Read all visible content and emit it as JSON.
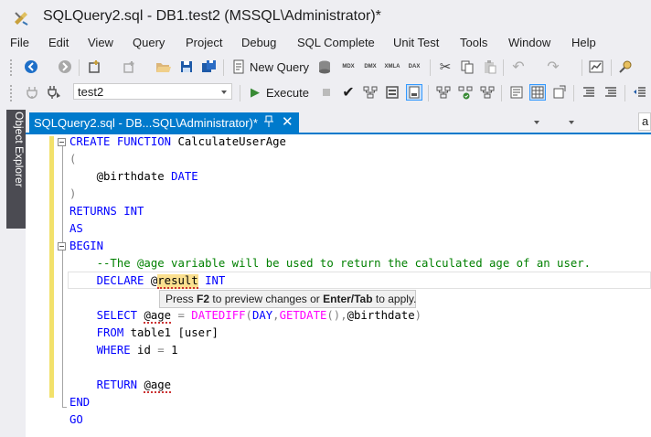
{
  "window": {
    "title": "SQLQuery2.sql - DB1.test2 (MSSQL\\Administrator)*"
  },
  "menu": [
    "File",
    "Edit",
    "View",
    "Query",
    "Project",
    "Debug",
    "SQL Complete",
    "Unit Test",
    "Tools",
    "Window",
    "Help"
  ],
  "toolbar1": {
    "new_query_label": "New Query",
    "query_type_icons": [
      "MDX",
      "DMX",
      "XMLA",
      "DAX"
    ],
    "search_partial": "a"
  },
  "toolbar2": {
    "database": "test2",
    "execute_label": "Execute"
  },
  "side_panel": {
    "label": "Object Explorer"
  },
  "document_tab": {
    "label": "SQLQuery2.sql - DB...SQL\\Administrator)*"
  },
  "editor": {
    "lines": [
      {
        "segments": [
          {
            "t": "CREATE FUNCTION",
            "c": "kw"
          },
          {
            "t": " CalculateUserAge",
            "c": ""
          }
        ]
      },
      {
        "segments": [
          {
            "t": "(",
            "c": "op"
          }
        ]
      },
      {
        "segments": [
          {
            "t": "    @birthdate ",
            "c": ""
          },
          {
            "t": "DATE",
            "c": "kw"
          }
        ]
      },
      {
        "segments": [
          {
            "t": ")",
            "c": "op"
          }
        ]
      },
      {
        "segments": [
          {
            "t": "RETURNS INT",
            "c": "kw"
          }
        ]
      },
      {
        "segments": [
          {
            "t": "AS",
            "c": "kw"
          }
        ]
      },
      {
        "segments": [
          {
            "t": "BEGIN",
            "c": "kw"
          }
        ]
      },
      {
        "segments": [
          {
            "t": "    --The @age variable will be used to return the calculated age of an user.",
            "c": "cm"
          }
        ]
      },
      {
        "segments": [
          {
            "t": "    ",
            "c": ""
          },
          {
            "t": "DECLARE",
            "c": "kw"
          },
          {
            "t": " @",
            "c": ""
          },
          {
            "t": "result",
            "c": "hl"
          },
          {
            "t": " ",
            "c": ""
          },
          {
            "t": "INT",
            "c": "kw"
          }
        ]
      },
      {
        "segments": []
      },
      {
        "segments": [
          {
            "t": "    ",
            "c": ""
          },
          {
            "t": "SELECT",
            "c": "kw"
          },
          {
            "t": " ",
            "c": ""
          },
          {
            "t": "@age",
            "c": "squig"
          },
          {
            "t": " ",
            "c": ""
          },
          {
            "t": "=",
            "c": "op"
          },
          {
            "t": " ",
            "c": ""
          },
          {
            "t": "DATEDIFF",
            "c": "fn"
          },
          {
            "t": "(",
            "c": "op"
          },
          {
            "t": "DAY",
            "c": "kw"
          },
          {
            "t": ",",
            "c": "op"
          },
          {
            "t": "GETDATE",
            "c": "fn"
          },
          {
            "t": "(),",
            "c": "op"
          },
          {
            "t": "@birthdate",
            "c": ""
          },
          {
            "t": ")",
            "c": "op"
          }
        ]
      },
      {
        "segments": [
          {
            "t": "    ",
            "c": ""
          },
          {
            "t": "FROM",
            "c": "kw"
          },
          {
            "t": " table1 [user]",
            "c": ""
          }
        ]
      },
      {
        "segments": [
          {
            "t": "    ",
            "c": ""
          },
          {
            "t": "WHERE",
            "c": "kw"
          },
          {
            "t": " id ",
            "c": ""
          },
          {
            "t": "=",
            "c": "op"
          },
          {
            "t": " 1",
            "c": ""
          }
        ]
      },
      {
        "segments": []
      },
      {
        "segments": [
          {
            "t": "    ",
            "c": ""
          },
          {
            "t": "RETURN",
            "c": "kw"
          },
          {
            "t": " ",
            "c": ""
          },
          {
            "t": "@age",
            "c": "squig"
          }
        ]
      },
      {
        "segments": [
          {
            "t": "END",
            "c": "kw"
          }
        ]
      },
      {
        "segments": [
          {
            "t": "GO",
            "c": "kw"
          }
        ]
      }
    ]
  },
  "tooltip": {
    "prefix": "Press ",
    "key1": "F2",
    "middle": " to preview changes or ",
    "key2": "Enter/Tab",
    "suffix": " to apply."
  }
}
